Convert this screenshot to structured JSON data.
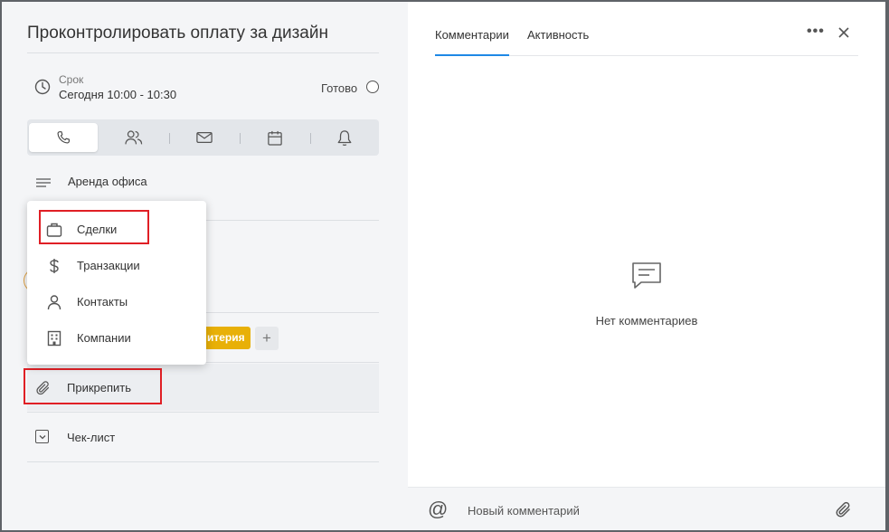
{
  "task": {
    "title": "Проконтролировать оплату за дизайн"
  },
  "due": {
    "label": "Срок",
    "value": "Сегодня 10:00 - 10:30"
  },
  "done_label": "Готово",
  "type_tabs": [
    {
      "icon": "phone-icon"
    },
    {
      "icon": "people-icon"
    },
    {
      "icon": "mail-icon"
    },
    {
      "icon": "calendar-icon"
    },
    {
      "icon": "bell-icon"
    }
  ],
  "description": "Аренда офиса",
  "tags": {
    "partial": "итерия",
    "add": "+"
  },
  "attach_label": "Прикрепить",
  "checklist_label": "Чек-лист",
  "dropdown": {
    "items": [
      {
        "label": "Сделки",
        "icon": "briefcase-icon"
      },
      {
        "label": "Транзакции",
        "icon": "dollar-icon"
      },
      {
        "label": "Контакты",
        "icon": "person-icon"
      },
      {
        "label": "Компании",
        "icon": "building-icon"
      }
    ]
  },
  "right": {
    "tabs": [
      "Комментарии",
      "Активность"
    ],
    "more": "•••",
    "empty_text": "Нет комментариев",
    "composer": {
      "at": "@",
      "placeholder": "Новый комментарий"
    }
  },
  "colors": {
    "accent": "#1e88e5",
    "highlight": "#e01f25",
    "tag": "#e8b007"
  }
}
